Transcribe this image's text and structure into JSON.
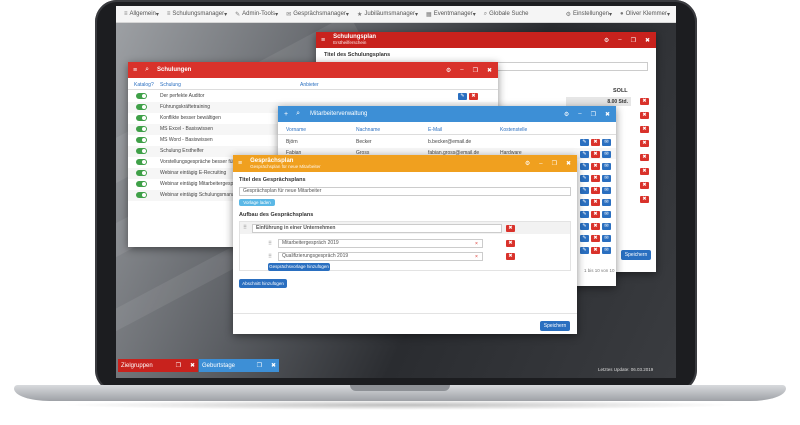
{
  "nav": {
    "items": [
      {
        "icon": "list-icon",
        "label": "Allgemein"
      },
      {
        "icon": "list-icon",
        "label": "Schulungsmanager"
      },
      {
        "icon": "wrench-icon",
        "label": "Admin-Tools"
      },
      {
        "icon": "chat-icon",
        "label": "Gesprächsmanager"
      },
      {
        "icon": "star-icon",
        "label": "Jubiläumsmanager"
      },
      {
        "icon": "calendar-icon",
        "label": "Eventmanager"
      },
      {
        "icon": "search-icon",
        "label": "Globale Suche"
      }
    ],
    "settings_label": "Einstellungen",
    "user_label": "Oliver Klemmer"
  },
  "schulungsplan": {
    "title": "Schulungsplan",
    "subtitle": "Erstheilferschein",
    "field_label": "Titel des Schulungsplans",
    "soll_label": "SOLL",
    "soll_value": "8.00 Std.",
    "save_label": "Speichern"
  },
  "schulungen": {
    "title": "Schulungen",
    "columns": [
      "Katalog?",
      "Schulung",
      "Anbieter"
    ],
    "rows": [
      "Der perfekte Auditor",
      "Führungskräftetraining",
      "Konflikte besser bewältigen",
      "MS Excel - Basiswissen",
      "MS Word - Basiswissen",
      "Schulung Ersthelfer",
      "Vorstellungsgespräche besser führen",
      "Webinar eintägig E-Recruiting",
      "Webinar eintägig Mitarbeitergespräche",
      "Webinar eintägig Schulungsmanagement"
    ]
  },
  "mitarbeiter": {
    "title": "Mitarbeiterverwaltung",
    "columns": [
      "Vorname",
      "Nachname",
      "E-Mail",
      "Kostenstelle"
    ],
    "rows": [
      {
        "vorname": "Björn",
        "nachname": "Becker",
        "email": "b.becker@email.de",
        "kostenstelle": ""
      },
      {
        "vorname": "Fabian",
        "nachname": "Gross",
        "email": "fabian.gross@email.de",
        "kostenstelle": "Hardware"
      }
    ],
    "pagination": "1 bis 10 von 10"
  },
  "gespraech": {
    "title": "Gesprächsplan",
    "subtitle": "Gesprächsplan für neue Mitarbeiter",
    "title_label": "Titel des Gesprächsplans",
    "title_value": "Gesprächsplan für neue Mitarbeiter",
    "vorlage_button": "Vorlage laden",
    "aufbau_label": "Aufbau des Gesprächsplans",
    "section_title": "Einführung in einer Unternehmen",
    "items": [
      "Mitarbeitergespräch 2019",
      "Qualifizierungsgespräch 2019"
    ],
    "add_item_button": "Gesprächsvorlage hinzufügen",
    "add_section_button": "Abschnitt hinzufügen",
    "save_label": "Speichern"
  },
  "taskbar": {
    "items": [
      "Zielgruppen",
      "Geburtstage"
    ],
    "last_update": "Letztes Update: 06.03.2019"
  },
  "colors": {
    "red": "#c8221d",
    "blue": "#3d8fd6",
    "orange": "#f0a01f"
  }
}
